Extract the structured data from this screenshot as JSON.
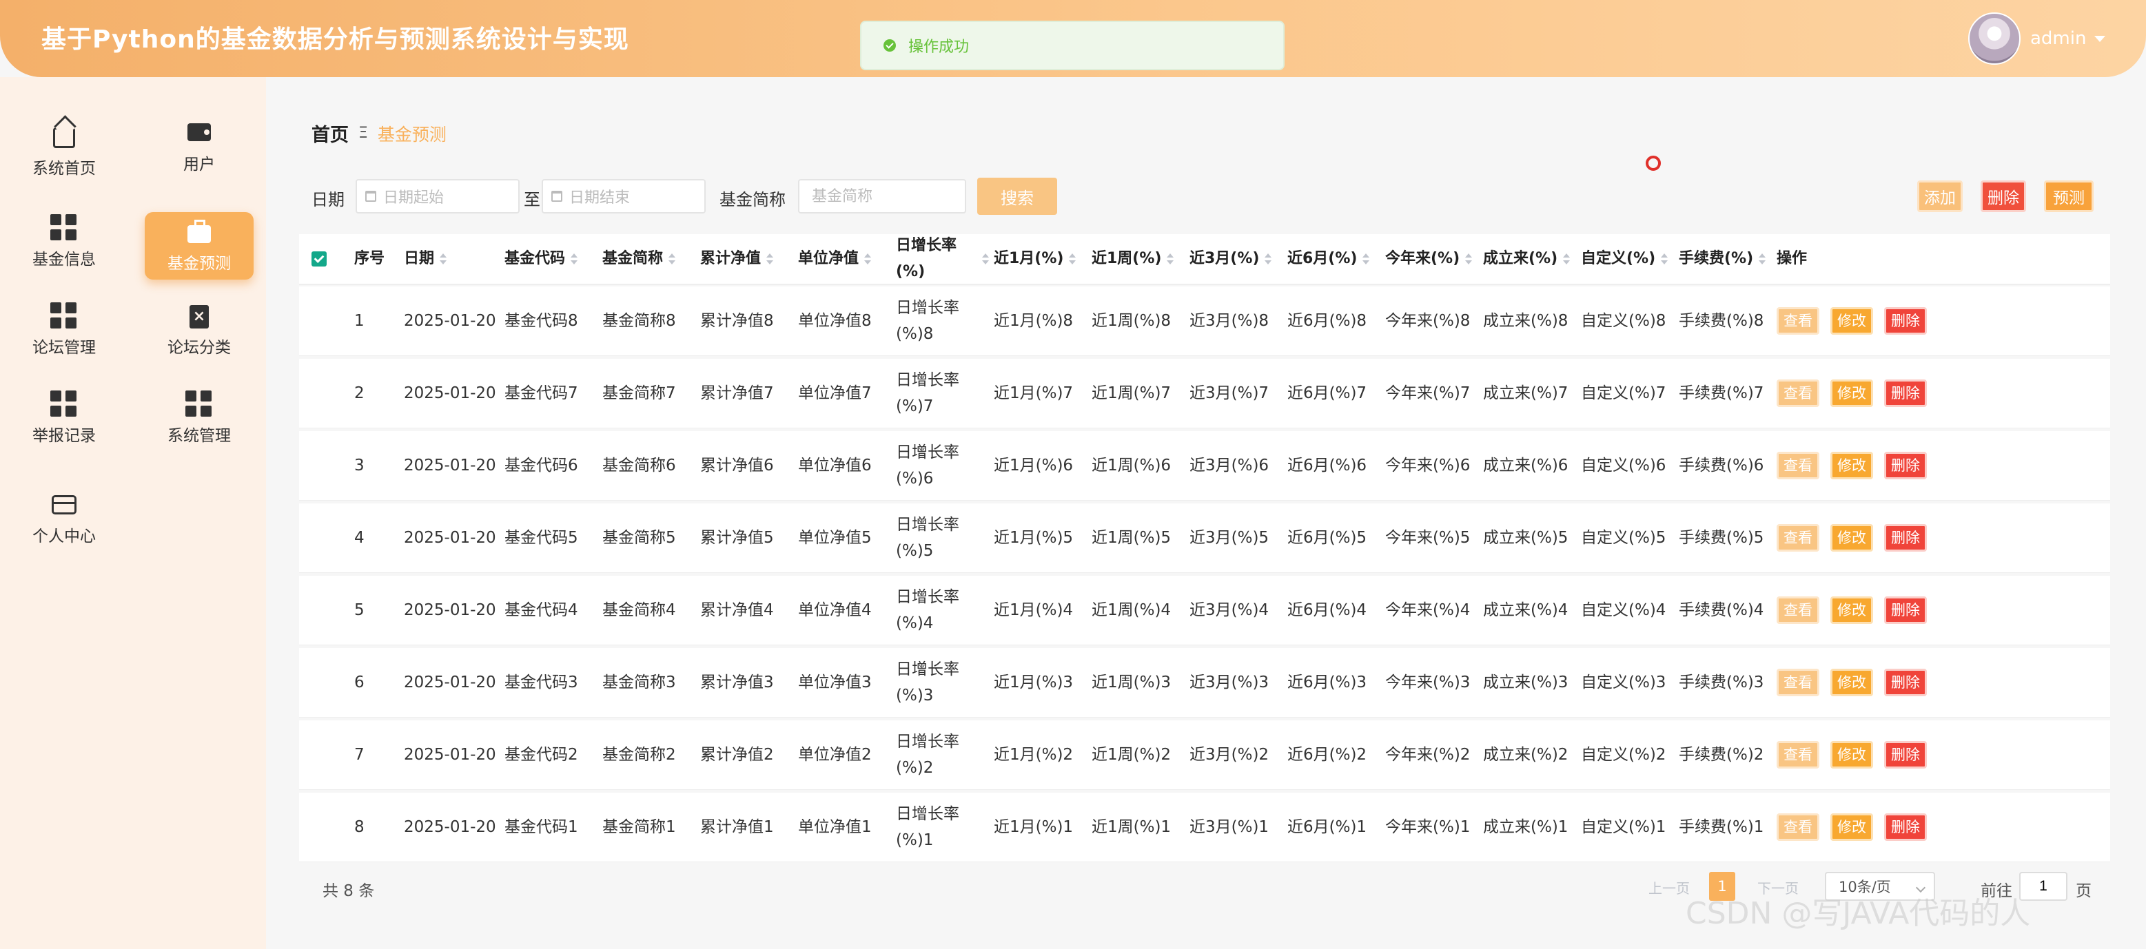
{
  "app": {
    "title": "基于Python的基金数据分析与预测系统设计与实现"
  },
  "toast": {
    "message": "操作成功"
  },
  "user": {
    "name": "admin"
  },
  "sidebar": {
    "items": [
      {
        "label": "系统首页",
        "icon": "home-icon"
      },
      {
        "label": "用户",
        "icon": "wallet-icon"
      },
      {
        "label": "基金信息",
        "icon": "grid-icon"
      },
      {
        "label": "基金预测",
        "icon": "briefcase-icon",
        "active": true
      },
      {
        "label": "论坛管理",
        "icon": "grid-icon"
      },
      {
        "label": "论坛分类",
        "icon": "clipboard-icon"
      },
      {
        "label": "举报记录",
        "icon": "grid-icon"
      },
      {
        "label": "系统管理",
        "icon": "grid-icon"
      },
      {
        "label": "个人中心",
        "icon": "card-icon"
      }
    ]
  },
  "breadcrumb": {
    "home": "首页",
    "separator": "Ξ",
    "current": "基金预测"
  },
  "filters": {
    "date_label": "日期",
    "date_start_placeholder": "日期起始",
    "to_label": "至",
    "date_end_placeholder": "日期结束",
    "name_label": "基金简称",
    "name_placeholder": "基金简称",
    "search_label": "搜索"
  },
  "toolbar": {
    "add": "添加",
    "delete": "删除",
    "predict": "预测"
  },
  "table": {
    "headers": [
      "序号",
      "日期",
      "基金代码",
      "基金简称",
      "累计净值",
      "单位净值",
      "日增长率(%)",
      "近1月(%)",
      "近1周(%)",
      "近3月(%)",
      "近6月(%)",
      "今年来(%)",
      "成立来(%)",
      "自定义(%)",
      "手续费(%)",
      "操作"
    ],
    "actions": {
      "view": "查看",
      "edit": "修改",
      "delete": "删除"
    },
    "rows": [
      [
        "1",
        "2025-01-20",
        "基金代码8",
        "基金简称8",
        "累计净值8",
        "单位净值8",
        "日增长率(%)8",
        "近1月(%)8",
        "近1周(%)8",
        "近3月(%)8",
        "近6月(%)8",
        "今年来(%)8",
        "成立来(%)8",
        "自定义(%)8",
        "手续费(%)8"
      ],
      [
        "2",
        "2025-01-20",
        "基金代码7",
        "基金简称7",
        "累计净值7",
        "单位净值7",
        "日增长率(%)7",
        "近1月(%)7",
        "近1周(%)7",
        "近3月(%)7",
        "近6月(%)7",
        "今年来(%)7",
        "成立来(%)7",
        "自定义(%)7",
        "手续费(%)7"
      ],
      [
        "3",
        "2025-01-20",
        "基金代码6",
        "基金简称6",
        "累计净值6",
        "单位净值6",
        "日增长率(%)6",
        "近1月(%)6",
        "近1周(%)6",
        "近3月(%)6",
        "近6月(%)6",
        "今年来(%)6",
        "成立来(%)6",
        "自定义(%)6",
        "手续费(%)6"
      ],
      [
        "4",
        "2025-01-20",
        "基金代码5",
        "基金简称5",
        "累计净值5",
        "单位净值5",
        "日增长率(%)5",
        "近1月(%)5",
        "近1周(%)5",
        "近3月(%)5",
        "近6月(%)5",
        "今年来(%)5",
        "成立来(%)5",
        "自定义(%)5",
        "手续费(%)5"
      ],
      [
        "5",
        "2025-01-20",
        "基金代码4",
        "基金简称4",
        "累计净值4",
        "单位净值4",
        "日增长率(%)4",
        "近1月(%)4",
        "近1周(%)4",
        "近3月(%)4",
        "近6月(%)4",
        "今年来(%)4",
        "成立来(%)4",
        "自定义(%)4",
        "手续费(%)4"
      ],
      [
        "6",
        "2025-01-20",
        "基金代码3",
        "基金简称3",
        "累计净值3",
        "单位净值3",
        "日增长率(%)3",
        "近1月(%)3",
        "近1周(%)3",
        "近3月(%)3",
        "近6月(%)3",
        "今年来(%)3",
        "成立来(%)3",
        "自定义(%)3",
        "手续费(%)3"
      ],
      [
        "7",
        "2025-01-20",
        "基金代码2",
        "基金简称2",
        "累计净值2",
        "单位净值2",
        "日增长率(%)2",
        "近1月(%)2",
        "近1周(%)2",
        "近3月(%)2",
        "近6月(%)2",
        "今年来(%)2",
        "成立来(%)2",
        "自定义(%)2",
        "手续费(%)2"
      ],
      [
        "8",
        "2025-01-20",
        "基金代码1",
        "基金简称1",
        "累计净值1",
        "单位净值1",
        "日增长率(%)1",
        "近1月(%)1",
        "近1周(%)1",
        "近3月(%)1",
        "近6月(%)1",
        "今年来(%)1",
        "成立来(%)1",
        "自定义(%)1",
        "手续费(%)1"
      ]
    ]
  },
  "pagination": {
    "total": "共 8 条",
    "prev": "上一页",
    "page": "1",
    "next": "下一页",
    "page_size": "10条/页",
    "goto_label": "前往",
    "goto_value": "1",
    "unit": "页"
  },
  "watermark": "CSDN @写JAVA代码的人",
  "colors": {
    "accent": "#f9b15c",
    "check": "#13a88a",
    "danger": "#f0443a"
  }
}
